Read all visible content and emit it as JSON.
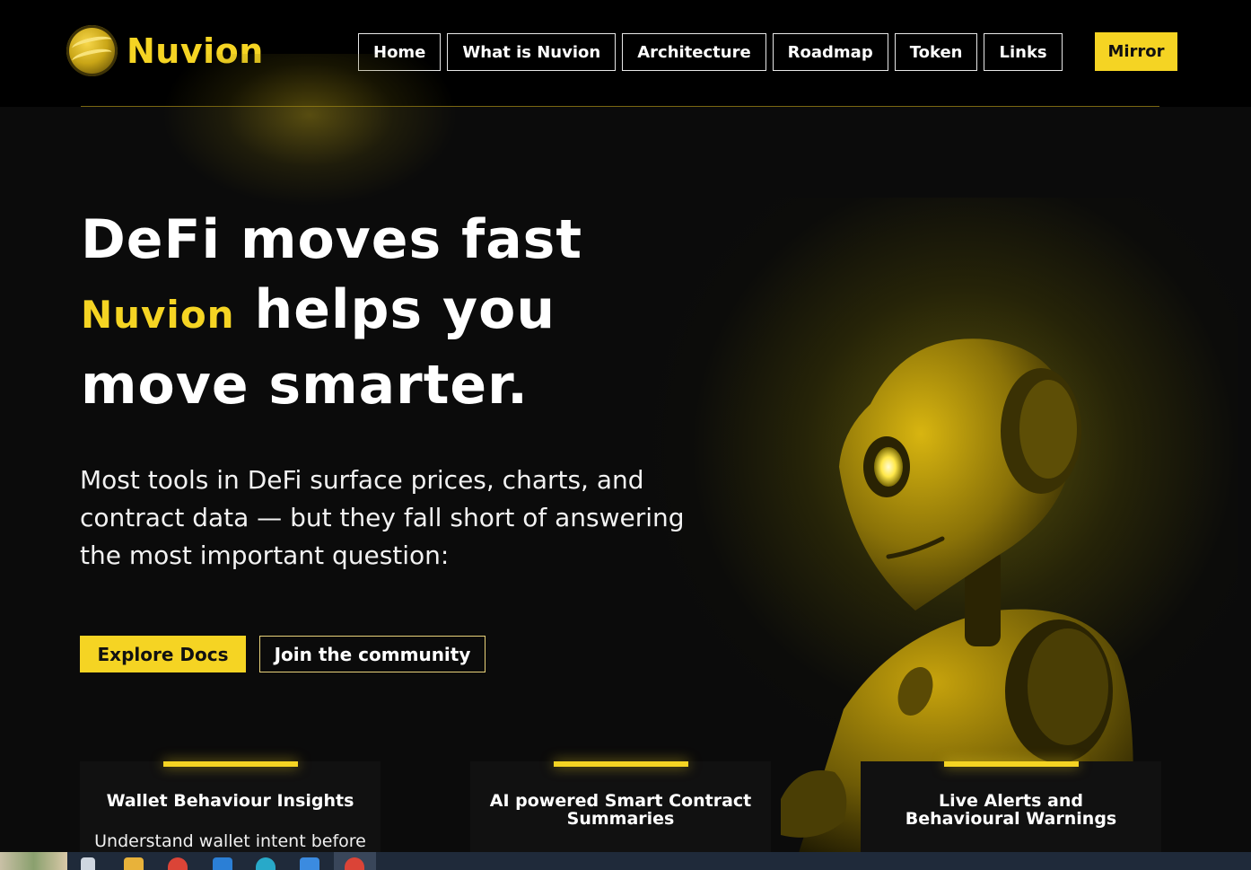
{
  "brand": {
    "name": "Nuvion",
    "logo_icon": "nuvion-logo-icon"
  },
  "nav": {
    "items": [
      {
        "label": "Home"
      },
      {
        "label": "What is Nuvion"
      },
      {
        "label": "Architecture"
      },
      {
        "label": "Roadmap"
      },
      {
        "label": "Token"
      },
      {
        "label": "Links"
      }
    ],
    "cta": "Mirror"
  },
  "hero": {
    "title_line1": "DeFi moves fast",
    "title_accent": "Nuvion",
    "title_line2_rest": " helps you",
    "title_line3": "move smarter.",
    "subtitle": "Most tools in DeFi surface prices, charts, and contract data — but they fall short of answering the most important question:",
    "primary_button": "Explore Docs",
    "secondary_button": "Join the community"
  },
  "features": [
    {
      "title": "Wallet Behaviour Insights",
      "text": "Understand wallet intent before"
    },
    {
      "title": "AI powered Smart Contract Summaries",
      "text": ""
    },
    {
      "title": "Live Alerts and Behavioural Warnings",
      "text": ""
    }
  ],
  "colors": {
    "accent": "#f5d423",
    "background": "#0b0b0b",
    "header": "#000000"
  },
  "taskbar": {
    "icons": [
      "task-view-icon",
      "file-explorer-icon",
      "chrome-icon",
      "vscode-icon",
      "edge-icon",
      "app-icon",
      "chrome-active-icon"
    ]
  }
}
